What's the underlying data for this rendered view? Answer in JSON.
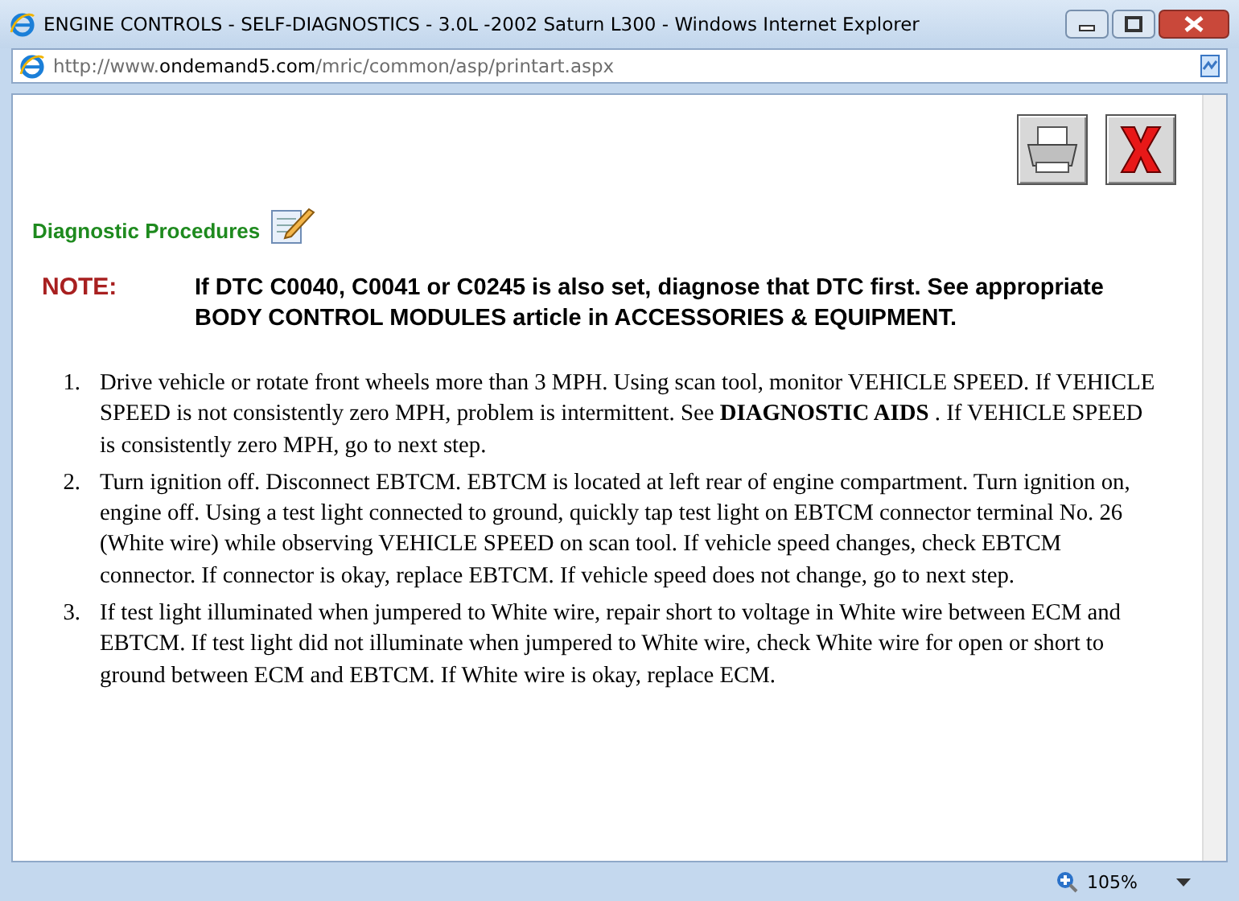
{
  "window": {
    "title": "ENGINE CONTROLS - SELF-DIAGNOSTICS - 3.0L -2002 Saturn L300 - Windows Internet Explorer"
  },
  "address_bar": {
    "url_prefix": "http://www.",
    "url_domain": "ondemand5.com",
    "url_path": "/mric/common/asp/printart.aspx"
  },
  "section": {
    "title": "Diagnostic Procedures"
  },
  "note": {
    "label": "NOTE:",
    "text": "If DTC C0040, C0041 or C0245 is also set, diagnose that DTC first. See appropriate BODY CONTROL MODULES article in ACCESSORIES & EQUIPMENT."
  },
  "steps": [
    {
      "number": "1.",
      "text": "Drive vehicle or rotate front wheels more than 3 MPH. Using scan tool, monitor VEHICLE SPEED. If VEHICLE SPEED is not consistently zero MPH, problem is intermittent. See **DIAGNOSTIC AIDS** . If VEHICLE SPEED is consistently zero MPH, go to next step."
    },
    {
      "number": "2.",
      "text": "Turn ignition off. Disconnect EBTCM. EBTCM is located at left rear of engine compartment. Turn ignition on, engine off. Using a test light connected to ground, quickly tap test light on EBTCM connector terminal No. 26 (White wire) while observing VEHICLE SPEED on scan tool. If vehicle speed changes, check EBTCM connector. If connector is okay, replace EBTCM. If vehicle speed does not change, go to next step."
    },
    {
      "number": "3.",
      "text": "If test light illuminated when jumpered to White wire, repair short to voltage in White wire between ECM and EBTCM. If test light did not illuminate when jumpered to White wire, check White wire for open or short to ground between ECM and EBTCM. If White wire is okay, replace ECM."
    }
  ],
  "status_bar": {
    "zoom": "105%"
  }
}
